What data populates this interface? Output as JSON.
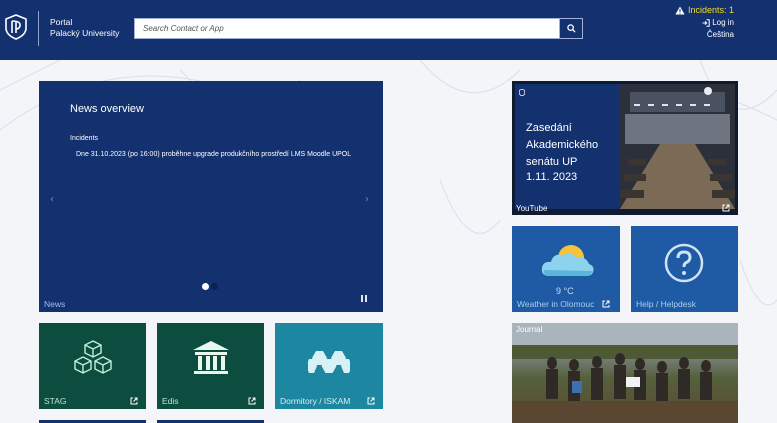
{
  "header": {
    "portal_line1": "Portal",
    "portal_line2": "Palacký University",
    "search_placeholder": "Search Contact or App",
    "incidents_label": "Incidents: 1",
    "login_label": "Log in",
    "language_label": "Čeština"
  },
  "news": {
    "title": "News overview",
    "subtitle": "Incidents",
    "text": "Dne 31.10.2023 (po 16:00) proběhne upgrade produkčního prostředí LMS Moodle UPOL",
    "label": "News"
  },
  "video": {
    "title_line1": "Zasedání",
    "title_line2": "Akademického",
    "title_line3": "senátu UP",
    "date": "1.11. 2023",
    "label": "YouTube"
  },
  "weather": {
    "temperature": "9 °C",
    "label": "Weather in Olomouc"
  },
  "help": {
    "label": "Help / Helpdesk"
  },
  "apps": {
    "stag": "STAG",
    "edis": "Edis",
    "dormitory": "Dormitory / ISKAM"
  },
  "journal": {
    "label": "Journal"
  },
  "colors": {
    "header": "#13306f",
    "incident_yellow": "#f2dd2b",
    "tile_green": "#0d4d3f",
    "tile_blue": "#1f5aa5",
    "tile_teal": "#1d86a0"
  }
}
